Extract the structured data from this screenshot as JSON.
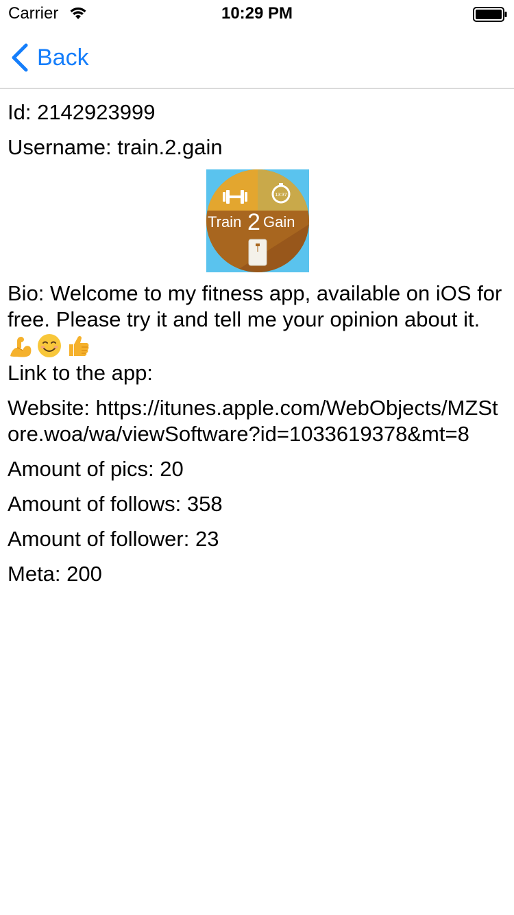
{
  "status_bar": {
    "carrier": "Carrier",
    "time": "10:29 PM"
  },
  "nav": {
    "back_label": "Back"
  },
  "profile": {
    "id_line": "Id: 2142923999",
    "username_line": "Username: train.2.gain",
    "avatar": {
      "app_name_prefix": "Train",
      "app_name_number": "2",
      "app_name_suffix": "Gain",
      "timer_text": "13:37"
    },
    "bio_text": "Bio: Welcome to my fitness app, available on iOS for free. Please try it and tell me your opinion about it. ",
    "bio_emojis": [
      "flexed-biceps",
      "smiling-face",
      "thumbs-up"
    ],
    "bio_link_line": "Link to the app:",
    "website_line": "Website: https://itunes.apple.com/WebObjects/MZStore.woa/wa/viewSoftware?id=1033619378&mt=8",
    "pics_line": "Amount of pics: 20",
    "follows_line": "Amount of follows: 358",
    "follower_line": "Amount of follower: 23",
    "meta_line": "Meta: 200"
  },
  "colors": {
    "ios_blue": "#157efb",
    "separator": "#b2b2b2"
  }
}
